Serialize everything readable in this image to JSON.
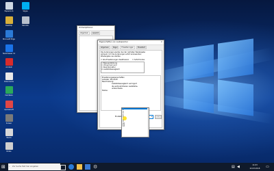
{
  "desktop_icons": [
    {
      "label": "Papierkorb",
      "icon": "recycle-bin-icon",
      "color": "#cfd8e3"
    },
    {
      "label": "Desktop",
      "icon": "app-icon",
      "color": "#d9b03a"
    },
    {
      "label": "Microsoft Edge",
      "icon": "edge-icon",
      "color": "#2b7ad6"
    },
    {
      "label": "TeamViewer 12",
      "icon": "teamviewer-icon",
      "color": "#1a73e8"
    },
    {
      "label": "Acrobat",
      "icon": "acrobat-icon",
      "color": "#d92b2b"
    },
    {
      "label": "Dokumente",
      "icon": "document-icon",
      "color": "#e9e9e9"
    },
    {
      "label": "Camtasia",
      "icon": "camtasia-icon",
      "color": "#2aa85a"
    },
    {
      "label": "Apowersoft",
      "icon": "apowersoft-icon",
      "color": "#e04646"
    },
    {
      "label": "Screen",
      "icon": "screen-icon",
      "color": "#7a7a7a"
    },
    {
      "label": "Studio",
      "icon": "studio-icon",
      "color": "#d8d8d8"
    },
    {
      "label": "Notes",
      "icon": "notes-icon",
      "color": "#cfcfcf"
    }
  ],
  "desktop_icons_col2": [
    {
      "label": "Skype",
      "icon": "skype-icon",
      "color": "#00aff0"
    },
    {
      "label": "Remote",
      "icon": "remote-icon",
      "color": "#b8c0cc"
    }
  ],
  "back_window": {
    "title": "Ordneroptionen",
    "tabs": [
      "Allgemein",
      "Ansicht",
      "Suchen"
    ]
  },
  "front_window": {
    "title": "Eigenschaften von Lautsprecher",
    "close": "✕",
    "tabs": [
      "Allgemein",
      "Pegel",
      "Erweiterungen",
      "Erweitert"
    ],
    "desc_lines": [
      "Die Änderungen werden bei der nächsten Wiedergabe",
      "wirksam. Um die Änderungen sofort anzuwenden,",
      "Wiedergabe neu starten."
    ],
    "check1": "Alle Erweiterungen deaktivieren",
    "check2": "Sofortmodus",
    "list_items": [
      "Bassverstärkung",
      "Virtual Surround",
      "Raumkorrektur",
      "Lautstärkeausgleich"
    ],
    "props_title": "Erweiterungseigenschaften",
    "props_label1": "Beschreibung:",
    "props_label2": "Anbieter:",
    "props_label3": "Status:",
    "props_value": "Microsoft",
    "props_desc": [
      "Lautstärkeausgleich verringert",
      "die wahrnehmbaren Lautstärke-",
      "unterschiede."
    ],
    "setting_label": "Einstellung:",
    "setting_value": "Freigabezeit",
    "settings_button": "...",
    "dropdown_options": [
      "1",
      "2",
      "3",
      "4",
      "5",
      "6",
      "7",
      "8",
      "9",
      "10",
      "11",
      "12"
    ],
    "selected_index": 0
  },
  "taskbar": {
    "search_placeholder": "Zur Suche Text hier eingeben",
    "time": "11:03",
    "date": "22.03.2018"
  }
}
